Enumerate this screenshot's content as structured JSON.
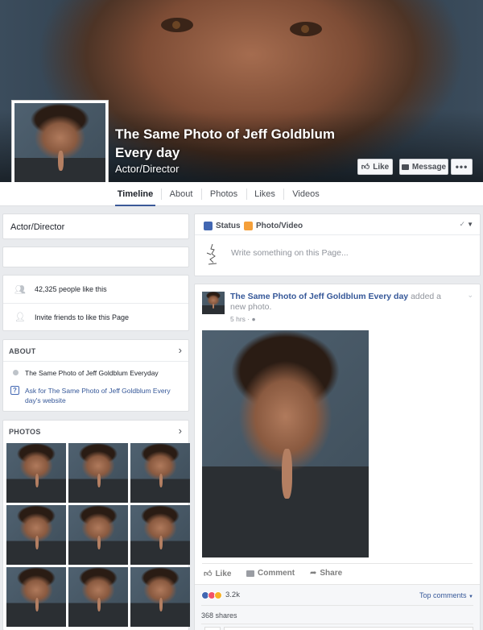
{
  "page": {
    "title": "The Same Photo of Jeff Goldblum Every day",
    "category": "Actor/Director"
  },
  "cover_buttons": {
    "like": "Like",
    "message": "Message",
    "more": "•••"
  },
  "nav": {
    "tabs": [
      {
        "label": "Timeline",
        "active": true
      },
      {
        "label": "About"
      },
      {
        "label": "Photos"
      },
      {
        "label": "Likes"
      },
      {
        "label": "Videos"
      }
    ]
  },
  "sidebar": {
    "category": "Actor/Director",
    "likes": "42,325 people like this",
    "invite": "Invite friends to like this Page",
    "about": {
      "heading": "ABOUT",
      "description": "The Same Photo of Jeff Goldblum Everyday",
      "ask_link": "Ask for The Same Photo of Jeff Goldblum Every day's website"
    },
    "photos": {
      "heading": "PHOTOS",
      "count": 9
    }
  },
  "composer": {
    "status_tab": "Status",
    "photo_tab": "Photo/Video",
    "placeholder": "Write something on this Page..."
  },
  "post": {
    "author": "The Same Photo of Jeff Goldblum Every day",
    "action_text": "added a new photo.",
    "time": "5 hrs",
    "actions": {
      "like": "Like",
      "comment": "Comment",
      "share": "Share"
    },
    "reactions_count": "3.2k",
    "top_comments": "Top comments",
    "shares": "368 shares"
  },
  "colors": {
    "brand": "#3b5998",
    "link": "#365899",
    "background": "#e9ebee"
  }
}
